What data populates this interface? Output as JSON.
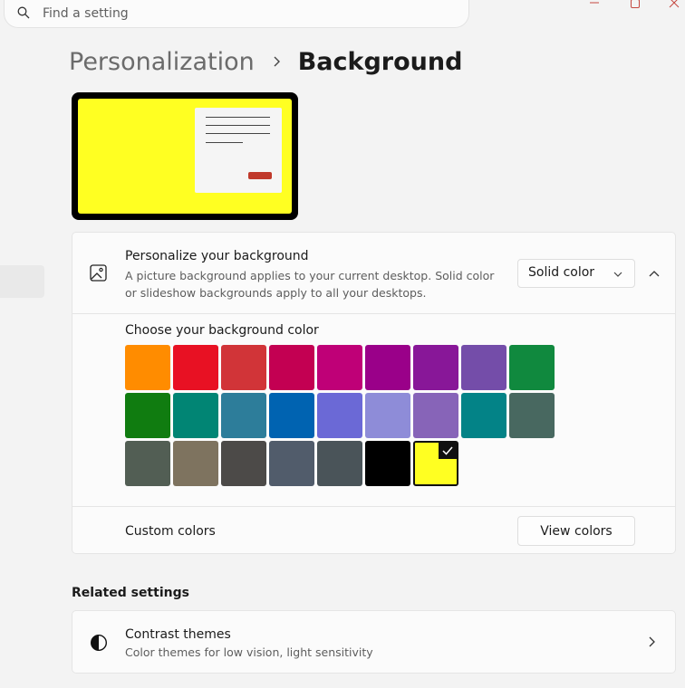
{
  "search": {
    "placeholder": "Find a setting"
  },
  "breadcrumb": {
    "parent": "Personalization",
    "current": "Background"
  },
  "preview": {
    "background_color": "#ffff22"
  },
  "personalize": {
    "title": "Personalize your background",
    "description": "A picture background applies to your current desktop. Solid color or slideshow backgrounds apply to all your desktops.",
    "dropdown_value": "Solid color"
  },
  "colors": {
    "title": "Choose your background color",
    "swatches": [
      "#ff8c00",
      "#e81123",
      "#d13438",
      "#c30052",
      "#bf0077",
      "#9a0089",
      "#881798",
      "#744da9",
      "#10893e",
      "#107c10",
      "#018574",
      "#2d7d9a",
      "#0063b1",
      "#6b69d6",
      "#8e8cd8",
      "#8764b8",
      "#038387",
      "#486860",
      "#525e54",
      "#7e735f",
      "#4c4a48",
      "#515c6b",
      "#4a5459",
      "#000000",
      "#ffff22"
    ],
    "selected_index": 24
  },
  "custom": {
    "label": "Custom colors",
    "button": "View colors"
  },
  "related": {
    "heading": "Related settings",
    "contrast_title": "Contrast themes",
    "contrast_desc": "Color themes for low vision, light sensitivity"
  }
}
